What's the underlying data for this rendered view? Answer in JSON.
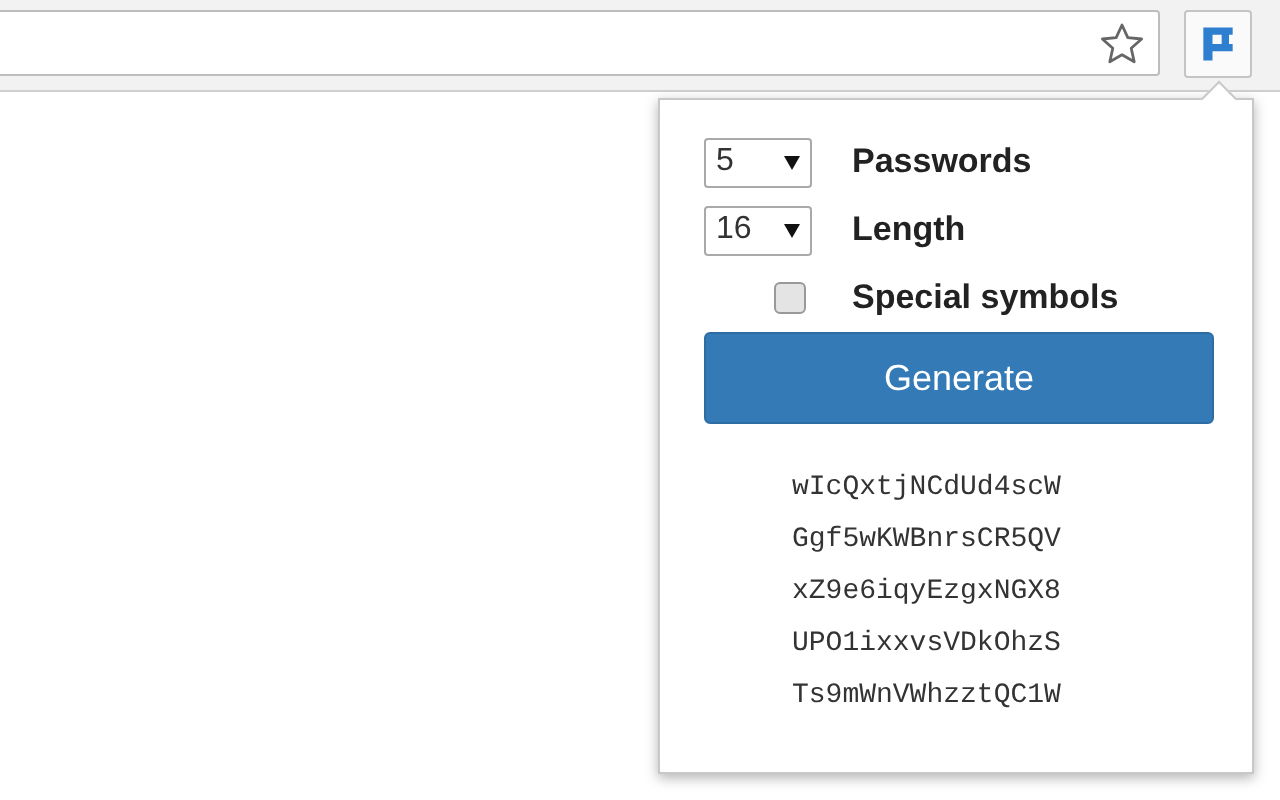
{
  "popup": {
    "settings": [
      {
        "kind": "select",
        "value": "5",
        "label": "Passwords"
      },
      {
        "kind": "select",
        "value": "16",
        "label": "Length"
      },
      {
        "kind": "checkbox",
        "checked": false,
        "label": "Special symbols"
      }
    ],
    "generate_button": "Generate",
    "passwords": [
      "wIcQxtjNCdUd4scW",
      "Ggf5wKWBnrsCR5QV",
      "xZ9e6iqyEzgxNGX8",
      "UPO1ixxvsVDkOhzS",
      "Ts9mWnVWhzztQC1W"
    ]
  }
}
